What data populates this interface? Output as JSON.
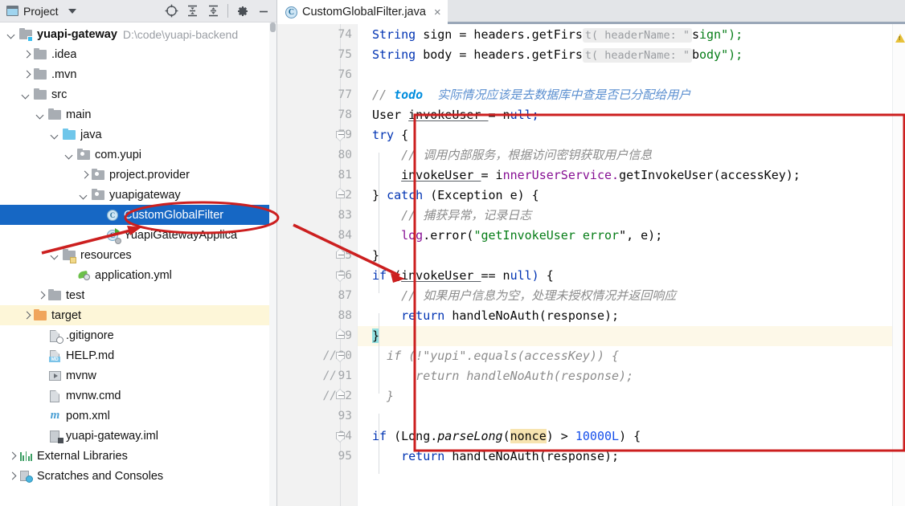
{
  "panel": {
    "title": "Project",
    "icons": {
      "panel": "project-window-icon",
      "dropdown": "chevron-down-icon",
      "locate": "locate-target-icon",
      "expand_all": "expand-all-icon",
      "collapse_all": "collapse-all-icon",
      "settings": "gear-icon",
      "minimize": "minimize-icon"
    }
  },
  "tree": [
    {
      "label": "yuapi-gateway",
      "path": "D:\\code\\yuapi-backend",
      "icon": "module-folder-icon",
      "twisty": "down",
      "indent": 0,
      "bold": true,
      "state": "normal"
    },
    {
      "label": ".idea",
      "path": "",
      "icon": "folder-icon",
      "twisty": "right",
      "indent": 1,
      "bold": false,
      "state": "normal"
    },
    {
      "label": ".mvn",
      "path": "",
      "icon": "folder-icon",
      "twisty": "right",
      "indent": 1,
      "bold": false,
      "state": "normal"
    },
    {
      "label": "src",
      "path": "",
      "icon": "folder-icon",
      "twisty": "down",
      "indent": 1,
      "bold": false,
      "state": "normal"
    },
    {
      "label": "main",
      "path": "",
      "icon": "folder-icon",
      "twisty": "down",
      "indent": 2,
      "bold": false,
      "state": "normal"
    },
    {
      "label": "java",
      "path": "",
      "icon": "source-folder-icon",
      "twisty": "down",
      "indent": 3,
      "bold": false,
      "state": "normal"
    },
    {
      "label": "com.yupi",
      "path": "",
      "icon": "package-icon",
      "twisty": "down",
      "indent": 4,
      "bold": false,
      "state": "normal"
    },
    {
      "label": "project.provider",
      "path": "",
      "icon": "package-icon",
      "twisty": "right",
      "indent": 5,
      "bold": false,
      "state": "normal"
    },
    {
      "label": "yuapigateway",
      "path": "",
      "icon": "package-icon",
      "twisty": "down",
      "indent": 5,
      "bold": false,
      "state": "normal"
    },
    {
      "label": "CustomGlobalFilter",
      "path": "",
      "icon": "java-class-icon",
      "twisty": "none",
      "indent": 6,
      "bold": false,
      "state": "selected"
    },
    {
      "label": "YuapiGatewayApplica",
      "path": "",
      "icon": "java-runnable-class-icon",
      "twisty": "none",
      "indent": 6,
      "bold": false,
      "state": "normal"
    },
    {
      "label": "resources",
      "path": "",
      "icon": "resource-folder-icon",
      "twisty": "down",
      "indent": 3,
      "bold": false,
      "state": "normal"
    },
    {
      "label": "application.yml",
      "path": "",
      "icon": "yaml-file-icon",
      "twisty": "none",
      "indent": 4,
      "bold": false,
      "state": "normal"
    },
    {
      "label": "test",
      "path": "",
      "icon": "folder-icon",
      "twisty": "right",
      "indent": 2,
      "bold": false,
      "state": "normal"
    },
    {
      "label": "target",
      "path": "",
      "icon": "excluded-folder-icon",
      "twisty": "right",
      "indent": 1,
      "bold": false,
      "state": "highlighted"
    },
    {
      "label": ".gitignore",
      "path": "",
      "icon": "gitignore-file-icon",
      "twisty": "none",
      "indent": 2,
      "bold": false,
      "state": "normal"
    },
    {
      "label": "HELP.md",
      "path": "",
      "icon": "markdown-file-icon",
      "twisty": "none",
      "indent": 2,
      "bold": false,
      "state": "normal"
    },
    {
      "label": "mvnw",
      "path": "",
      "icon": "script-file-icon",
      "twisty": "none",
      "indent": 2,
      "bold": false,
      "state": "normal"
    },
    {
      "label": "mvnw.cmd",
      "path": "",
      "icon": "cmd-file-icon",
      "twisty": "none",
      "indent": 2,
      "bold": false,
      "state": "normal"
    },
    {
      "label": "pom.xml",
      "path": "",
      "icon": "maven-file-icon",
      "twisty": "none",
      "indent": 2,
      "bold": false,
      "state": "normal"
    },
    {
      "label": "yuapi-gateway.iml",
      "path": "",
      "icon": "iml-file-icon",
      "twisty": "none",
      "indent": 2,
      "bold": false,
      "state": "normal"
    },
    {
      "label": "External Libraries",
      "path": "",
      "icon": "external-libraries-icon",
      "twisty": "right",
      "indent": 0,
      "bold": false,
      "state": "normal"
    },
    {
      "label": "Scratches and Consoles",
      "path": "",
      "icon": "scratches-icon",
      "twisty": "right",
      "indent": 0,
      "bold": false,
      "state": "normal"
    }
  ],
  "editor": {
    "tab": {
      "label": "CustomGlobalFilter.java",
      "icon": "java-class-icon",
      "close": "×"
    },
    "first_line": 74,
    "caret_line": 89,
    "inspection_icon": "warning-triangle-icon",
    "lines": [
      {
        "n": 74,
        "fold": "none",
        "comment_mark": ""
      },
      {
        "n": 75,
        "fold": "none",
        "comment_mark": ""
      },
      {
        "n": 76,
        "fold": "none",
        "comment_mark": ""
      },
      {
        "n": 77,
        "fold": "none",
        "comment_mark": ""
      },
      {
        "n": 78,
        "fold": "none",
        "comment_mark": ""
      },
      {
        "n": 79,
        "fold": "start",
        "comment_mark": ""
      },
      {
        "n": 80,
        "fold": "none",
        "comment_mark": ""
      },
      {
        "n": 81,
        "fold": "none",
        "comment_mark": ""
      },
      {
        "n": 82,
        "fold": "end",
        "comment_mark": ""
      },
      {
        "n": 83,
        "fold": "none",
        "comment_mark": ""
      },
      {
        "n": 84,
        "fold": "none",
        "comment_mark": ""
      },
      {
        "n": 85,
        "fold": "end",
        "comment_mark": ""
      },
      {
        "n": 86,
        "fold": "start",
        "comment_mark": ""
      },
      {
        "n": 87,
        "fold": "none",
        "comment_mark": ""
      },
      {
        "n": 88,
        "fold": "none",
        "comment_mark": ""
      },
      {
        "n": 89,
        "fold": "end",
        "comment_mark": ""
      },
      {
        "n": 90,
        "fold": "start",
        "comment_mark": "//"
      },
      {
        "n": 91,
        "fold": "none",
        "comment_mark": "//"
      },
      {
        "n": 92,
        "fold": "end",
        "comment_mark": "//"
      },
      {
        "n": 93,
        "fold": "none",
        "comment_mark": ""
      },
      {
        "n": 94,
        "fold": "start",
        "comment_mark": ""
      },
      {
        "n": 95,
        "fold": "none",
        "comment_mark": ""
      }
    ],
    "code_text": [
      "String sign = headers.getFirst( headerName: \"sign\");",
      "String body = headers.getFirst( headerName: \"body\");",
      "",
      "// todo  实际情况应该是去数据库中查是否已分配给用户",
      "User invokeUser = null;",
      "try {",
      "    // 调用内部服务，根据访问密钥获取用户信息",
      "    invokeUser = innerUserService.getInvokeUser(accessKey);",
      "} catch (Exception e) {",
      "    // 捕获异常，记录日志",
      "    log.error(\"getInvokeUser error\", e);",
      "}",
      "if (invokeUser == null) {",
      "    // 如果用户信息为空，处理未授权情况并返回响应",
      "    return handleNoAuth(response);",
      "}",
      "  if (!\"yupi\".equals(accessKey)) {",
      "      return handleNoAuth(response);",
      "  }",
      "",
      "if (Long.parseLong(nonce) > 10000L) {",
      "    return handleNoAuth(response);"
    ]
  },
  "annotations": {
    "ellipse_target": "CustomGlobalFilter",
    "arrow_1": "points-to-custom-global-filter-tree-item",
    "arrow_2": "points-to-code-block",
    "rect": "highlights-invoke-user-code-block",
    "color": "#cc1f1f"
  },
  "colors": {
    "selection": "#1667c4",
    "highlight_row": "#fdf6d8",
    "keyword": "#0033b3",
    "string": "#067d17",
    "number": "#1750eb",
    "field": "#871094",
    "comment": "#8c8c8c",
    "todo": "#008dde",
    "annotation_red": "#cc1f1f",
    "caret_line": "#fdf8e8",
    "brace_match": "#93e0e0",
    "find_match": "#f7e4b0"
  }
}
